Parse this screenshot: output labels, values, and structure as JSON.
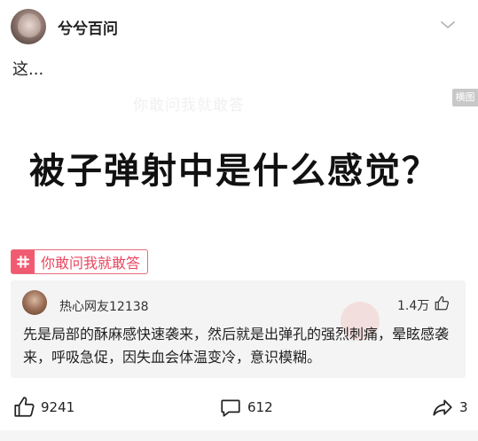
{
  "post": {
    "author": "兮兮百问",
    "caption": "这...",
    "headline": "被子弹射中是什么感觉？",
    "watermark": "你敢问我就敢答",
    "landscape_badge": "横图"
  },
  "topic": {
    "label": "你敢问我就敢答"
  },
  "top_comment": {
    "username": "热心网友12138",
    "likes": "1.4万",
    "text": "先是局部的酥麻感快速袭来，然后就是出弹孔的强烈刺痛，晕眩感袭来，呼吸急促，因失血会体温变冷，意识模糊。"
  },
  "actions": {
    "like_count": "9241",
    "comment_count": "612",
    "share_count": "3"
  },
  "icons": [
    "chevron-down-icon",
    "hashtag-icon",
    "thumb-up-icon",
    "comment-bubble-icon",
    "share-arrow-icon"
  ],
  "colors": {
    "topic_accent": "#f05b72",
    "card_bg": "#f4f4f4"
  }
}
